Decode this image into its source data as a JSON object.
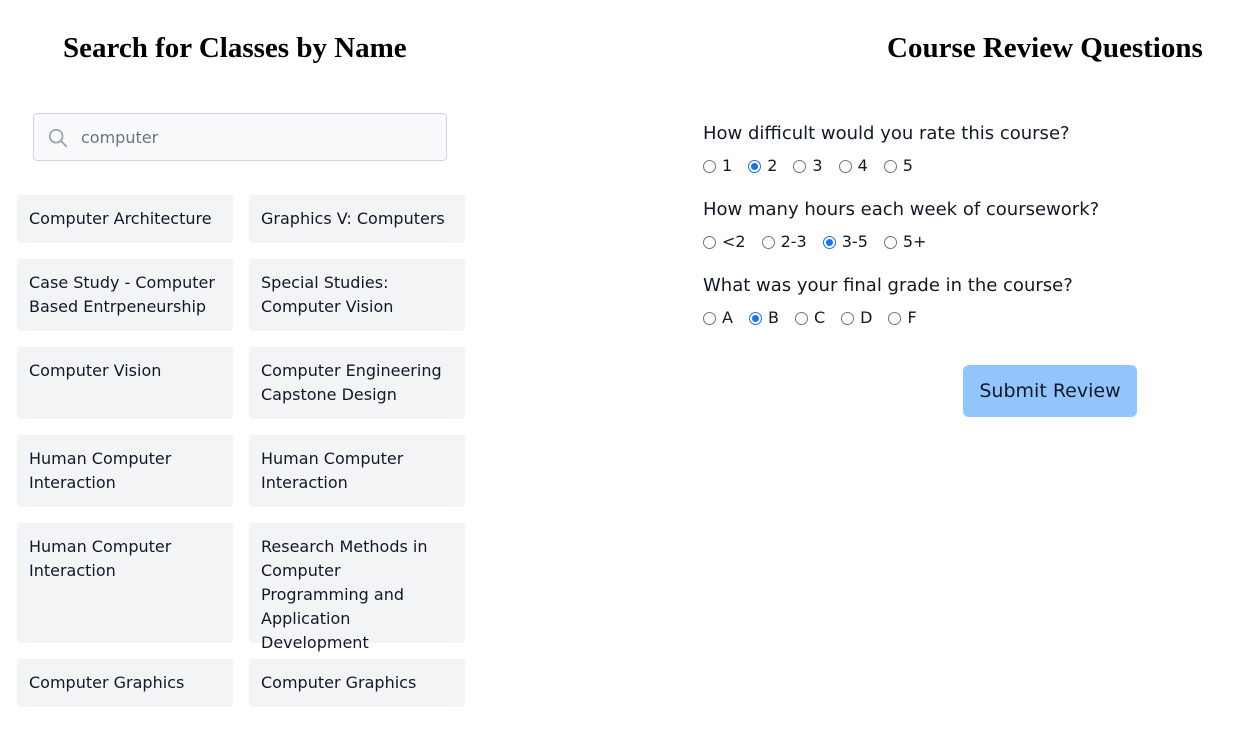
{
  "left": {
    "title": "Search for Classes by Name",
    "search": {
      "value": "computer",
      "icon": "search-icon"
    },
    "classes": [
      "Computer Architecture",
      "Graphics V: Computers",
      "Case Study - Computer Based Entrpeneurship",
      "Special Studies: Computer Vision",
      "Computer Vision",
      "Computer Engineering Capstone Design",
      "Human Computer Interaction",
      "Human Computer Interaction",
      "Human Computer Interaction",
      "Research Methods in Computer Programming and Application Development",
      "Computer Graphics",
      "Computer Graphics"
    ]
  },
  "right": {
    "title": "Course Review Questions",
    "questions": [
      {
        "text": "How difficult would you rate this course?",
        "options": [
          "1",
          "2",
          "3",
          "4",
          "5"
        ],
        "selected": "2"
      },
      {
        "text": "How many hours each week of coursework?",
        "options": [
          "<2",
          "2-3",
          "3-5",
          "5+"
        ],
        "selected": "3-5"
      },
      {
        "text": "What was your final grade in the course?",
        "options": [
          "A",
          "B",
          "C",
          "D",
          "F"
        ],
        "selected": "B"
      }
    ],
    "submit_label": "Submit Review"
  },
  "colors": {
    "accent": "#1a73e8",
    "button": "#93c5fd",
    "card": "#f3f4f6"
  }
}
